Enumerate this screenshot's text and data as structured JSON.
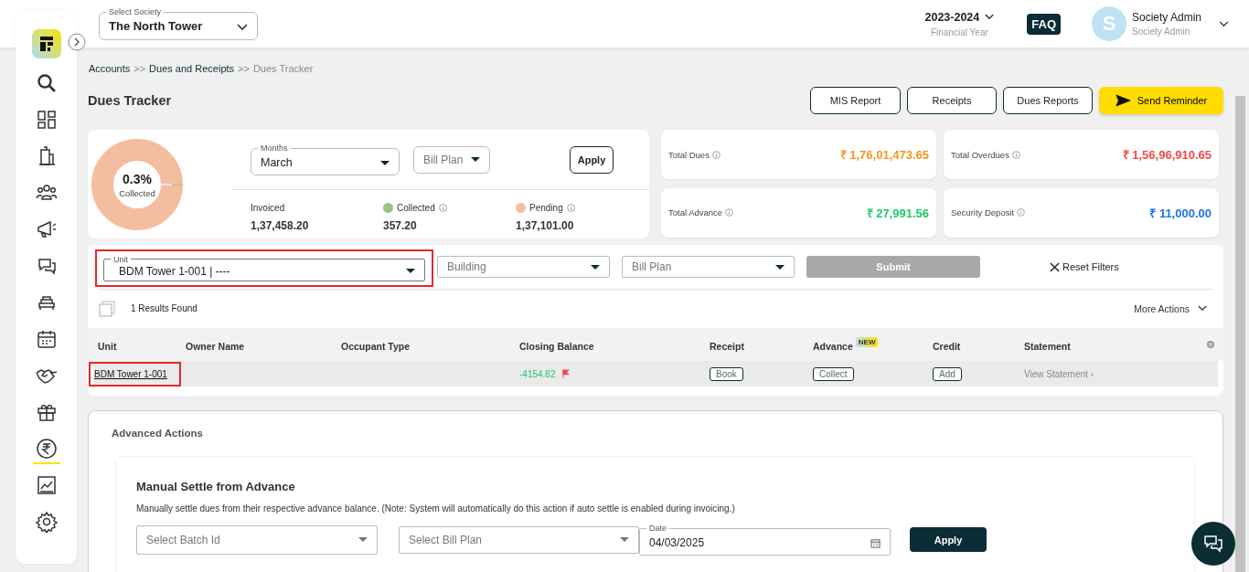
{
  "header": {
    "society_select": {
      "label": "Select Society",
      "value": "The North Tower"
    },
    "year": {
      "value": "2023-2024",
      "caption": "Financial Year"
    },
    "faq": "FAQ",
    "user": {
      "initial": "S",
      "name": "Society Admin",
      "role": "Society Admin"
    }
  },
  "sidebar": {
    "items": [
      {
        "selected": false
      },
      {
        "selected": false
      },
      {
        "selected": false
      },
      {
        "selected": false
      },
      {
        "selected": false
      },
      {
        "selected": false
      },
      {
        "selected": false
      },
      {
        "selected": false
      },
      {
        "selected": false
      },
      {
        "selected": false
      },
      {
        "selected": true
      },
      {
        "selected": false
      },
      {
        "selected": false
      }
    ]
  },
  "breadcrumb": [
    {
      "label": "Accounts",
      "current": false
    },
    {
      "label": "Dues and Receipts",
      "current": false
    },
    {
      "label": "Dues Tracker",
      "current": true
    }
  ],
  "breadcrumb_separator": ">>",
  "page_title": "Dues Tracker",
  "actions": [
    {
      "label": "MIS Report",
      "kind": "outline"
    },
    {
      "label": "Receipts",
      "kind": "outline"
    },
    {
      "label": "Dues Reports",
      "kind": "outline"
    },
    {
      "label": "Send Reminder",
      "kind": "primary"
    }
  ],
  "summary": {
    "donut": {
      "percent": "0.3%",
      "caption": "Collected",
      "level": 0.003
    },
    "months": {
      "label": "Months",
      "value": "March"
    },
    "bill_plan": {
      "placeholder": "Bill Plan"
    },
    "apply": "Apply",
    "stats": [
      {
        "label": "Invoiced",
        "value": "1,37,458.20",
        "info": false
      },
      {
        "label": "Collected",
        "value": "357.20",
        "info": true,
        "color": "#9dc183"
      },
      {
        "label": "Pending",
        "value": "1,37,101.00",
        "info": true,
        "color": "#f5bda0"
      }
    ]
  },
  "totals": [
    {
      "label": "Total Dues",
      "value": "₹ 1,76,01,473.65",
      "color": "#f7931e"
    },
    {
      "label": "Total Overdues",
      "value": "₹ 1,56,96,910.65",
      "color": "#f04848"
    },
    {
      "label": "Total Advance",
      "value": "₹ 27,991.56",
      "color": "#1ec96b"
    },
    {
      "label": "Security Deposit",
      "value": "₹ 11,000.00",
      "color": "#1a73e8"
    }
  ],
  "filters": {
    "unit": {
      "label": "Unit",
      "value": "BDM Tower 1-001 | ----",
      "highlighted": true
    },
    "building": {
      "placeholder": "Building"
    },
    "bill_plan": {
      "placeholder": "Bill Plan"
    },
    "submit": {
      "label": "Submit",
      "disabled": true
    },
    "reset": "Reset Filters"
  },
  "results": {
    "checked": false,
    "count": "1 Results Found",
    "more_actions": "More Actions"
  },
  "table": {
    "columns": [
      {
        "label": "Unit"
      },
      {
        "label": "Owner Name"
      },
      {
        "label": "Occupant Type"
      },
      {
        "label": "Closing Balance"
      },
      {
        "label": "Receipt"
      },
      {
        "label": "Advance",
        "badge": "NEW"
      },
      {
        "label": "Credit"
      },
      {
        "label": "Statement"
      }
    ],
    "rows": [
      {
        "unit": "BDM Tower 1-001",
        "unit_highlighted": true,
        "closing_balance": "-4154.82",
        "flagged": true,
        "receipt": "Book",
        "advance": "Collect",
        "credit": "Add",
        "statement": "View Statement ›"
      }
    ]
  },
  "advanced": {
    "title": "Advanced Actions",
    "section": {
      "title": "Manual Settle from Advance",
      "description": "Manually settle dues from their respective advance balance. (Note: System will automatically do this action if auto settle is enabled during invoicing.)",
      "batch": {
        "placeholder": "Select Batch Id"
      },
      "bill_plan": {
        "placeholder": "Select Bill Plan"
      },
      "date": {
        "label": "Date",
        "value": "04/03/2025"
      },
      "apply": "Apply"
    }
  }
}
